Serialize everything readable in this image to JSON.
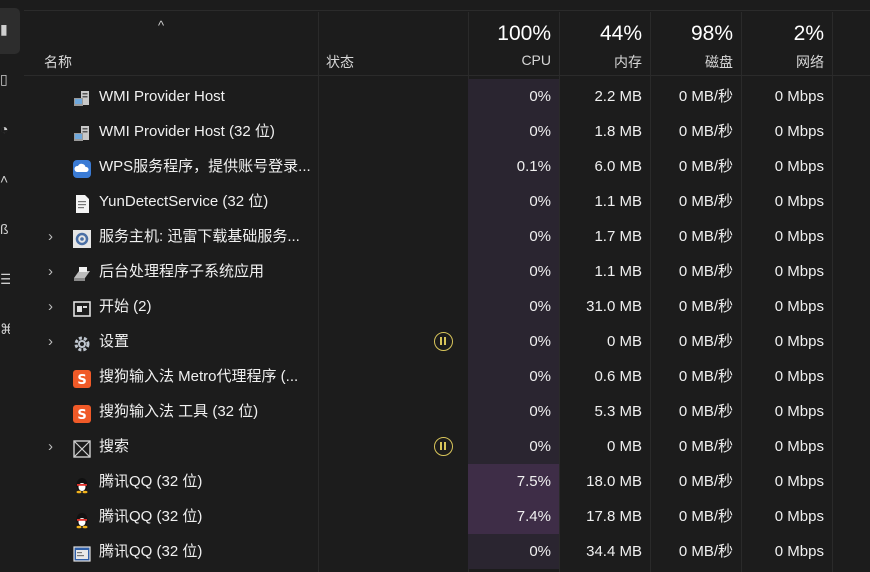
{
  "header": {
    "sort_arrow": "^",
    "name_label": "名称",
    "status_label": "状态",
    "cpu_pct": "100%",
    "cpu_label": "CPU",
    "mem_pct": "44%",
    "mem_label": "内存",
    "disk_pct": "98%",
    "disk_label": "磁盘",
    "net_pct": "2%",
    "net_label": "网络"
  },
  "rows": [
    {
      "name": "WMI Provider Host",
      "cpu": "0%",
      "mem": "2.2 MB",
      "disk": "0 MB/秒",
      "net": "0 Mbps",
      "icon": "wmi-host-icon",
      "expandable": false,
      "status": ""
    },
    {
      "name": "WMI Provider Host (32 位)",
      "cpu": "0%",
      "mem": "1.8 MB",
      "disk": "0 MB/秒",
      "net": "0 Mbps",
      "icon": "wmi-host-icon",
      "expandable": false,
      "status": ""
    },
    {
      "name": "WPS服务程序，提供账号登录...",
      "cpu": "0.1%",
      "mem": "6.0 MB",
      "disk": "0 MB/秒",
      "net": "0 Mbps",
      "icon": "cloud-icon",
      "expandable": false,
      "status": ""
    },
    {
      "name": "YunDetectService (32 位)",
      "cpu": "0%",
      "mem": "1.1 MB",
      "disk": "0 MB/秒",
      "net": "0 Mbps",
      "icon": "document-icon",
      "expandable": false,
      "status": ""
    },
    {
      "name": "服务主机: 迅雷下载基础服务...",
      "cpu": "0%",
      "mem": "1.7 MB",
      "disk": "0 MB/秒",
      "net": "0 Mbps",
      "icon": "gear-icon",
      "expandable": true,
      "status": ""
    },
    {
      "name": "后台处理程序子系统应用",
      "cpu": "0%",
      "mem": "1.1 MB",
      "disk": "0 MB/秒",
      "net": "0 Mbps",
      "icon": "printer-icon",
      "expandable": true,
      "status": ""
    },
    {
      "name": "开始 (2)",
      "cpu": "0%",
      "mem": "31.0 MB",
      "disk": "0 MB/秒",
      "net": "0 Mbps",
      "icon": "window-icon",
      "expandable": true,
      "status": ""
    },
    {
      "name": "设置",
      "cpu": "0%",
      "mem": "0 MB",
      "disk": "0 MB/秒",
      "net": "0 Mbps",
      "icon": "settings-gear-icon",
      "expandable": true,
      "status": "suspended"
    },
    {
      "name": "搜狗输入法 Metro代理程序 (...",
      "cpu": "0%",
      "mem": "0.6 MB",
      "disk": "0 MB/秒",
      "net": "0 Mbps",
      "icon": "sogou-icon",
      "expandable": false,
      "status": ""
    },
    {
      "name": "搜狗输入法 工具 (32 位)",
      "cpu": "0%",
      "mem": "5.3 MB",
      "disk": "0 MB/秒",
      "net": "0 Mbps",
      "icon": "sogou-icon",
      "expandable": false,
      "status": ""
    },
    {
      "name": "搜索",
      "cpu": "0%",
      "mem": "0 MB",
      "disk": "0 MB/秒",
      "net": "0 Mbps",
      "icon": "search-app-icon",
      "expandable": true,
      "status": "suspended"
    },
    {
      "name": "腾讯QQ (32 位)",
      "cpu": "7.5%",
      "mem": "18.0 MB",
      "disk": "0 MB/秒",
      "net": "0 Mbps",
      "icon": "qq-penguin-icon",
      "expandable": false,
      "status": ""
    },
    {
      "name": "腾讯QQ (32 位)",
      "cpu": "7.4%",
      "mem": "17.8 MB",
      "disk": "0 MB/秒",
      "net": "0 Mbps",
      "icon": "qq-penguin-icon",
      "expandable": false,
      "status": ""
    },
    {
      "name": "腾讯QQ (32 位)",
      "cpu": "0%",
      "mem": "34.4 MB",
      "disk": "0 MB/秒",
      "net": "0 Mbps",
      "icon": "app-window-icon",
      "expandable": false,
      "status": ""
    }
  ],
  "colors": {
    "background": "#1c1c1c",
    "cpu_column_bg": "#2a2530",
    "cpu_hot_bg": "#3e2d47",
    "suspended_icon": "#d7c45a"
  }
}
